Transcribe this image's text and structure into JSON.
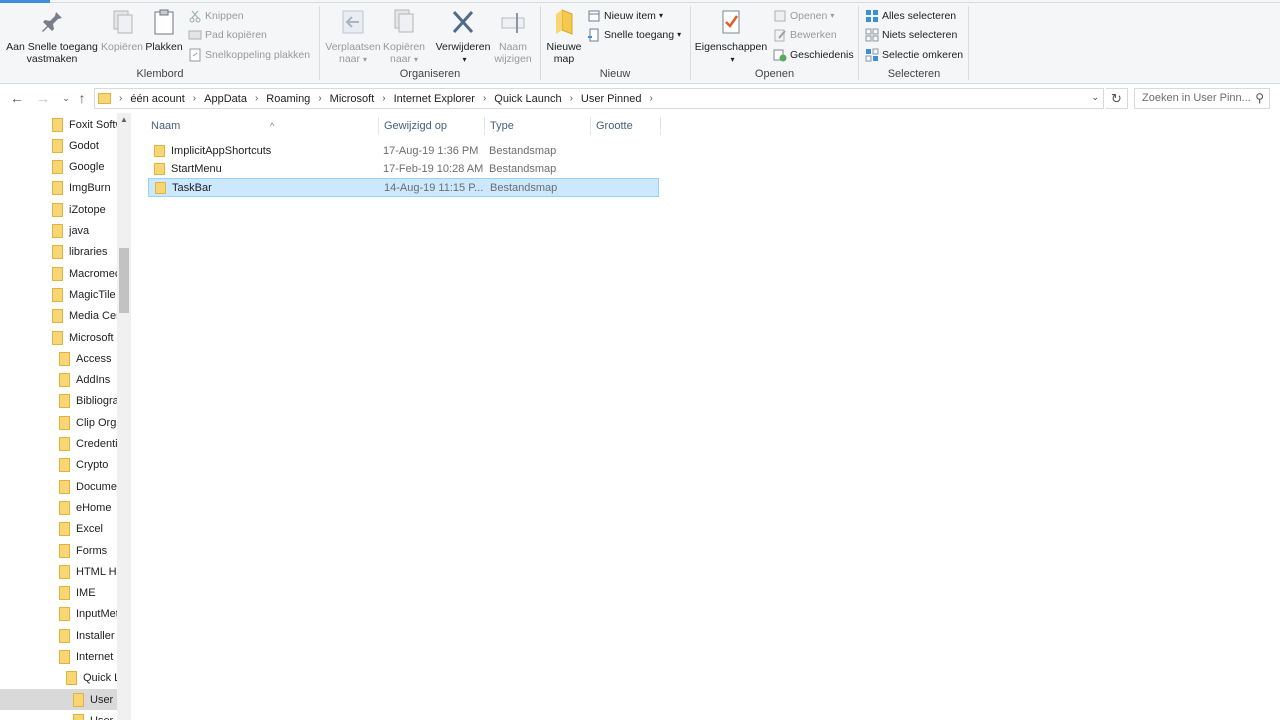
{
  "ribbon": {
    "klembord": {
      "label": "Klembord",
      "pin": "Aan Snelle toegang vastmaken",
      "copy": "Kopiëren",
      "paste": "Plakken",
      "cut": "Knippen",
      "copy_path": "Pad kopiëren",
      "paste_shortcut": "Snelkoppeling plakken"
    },
    "organiseren": {
      "label": "Organiseren",
      "move_to": "Verplaatsen naar",
      "copy_to": "Kopiëren naar",
      "delete": "Verwijderen",
      "rename": "Naam wijzigen"
    },
    "nieuw": {
      "label": "Nieuw",
      "new_folder": "Nieuwe map",
      "new_item": "Nieuw item",
      "easy_access": "Snelle toegang"
    },
    "openen": {
      "label": "Openen",
      "properties": "Eigenschappen",
      "open": "Openen",
      "edit": "Bewerken",
      "history": "Geschiedenis"
    },
    "selecteren": {
      "label": "Selecteren",
      "select_all": "Alles selecteren",
      "select_none": "Niets selecteren",
      "invert": "Selectie omkeren"
    }
  },
  "address": {
    "crumbs": [
      "één acount",
      "AppData",
      "Roaming",
      "Microsoft",
      "Internet Explorer",
      "Quick Launch",
      "User Pinned"
    ],
    "search_placeholder": "Zoeken in User Pinn..."
  },
  "nav": {
    "items": [
      {
        "label": "Foxit Softw",
        "level": 0
      },
      {
        "label": "Godot",
        "level": 0
      },
      {
        "label": "Google",
        "level": 0
      },
      {
        "label": "ImgBurn",
        "level": 0
      },
      {
        "label": "iZotope",
        "level": 0
      },
      {
        "label": "java",
        "level": 0
      },
      {
        "label": "libraries",
        "level": 0
      },
      {
        "label": "Macromec",
        "level": 0
      },
      {
        "label": "MagicTile",
        "level": 0
      },
      {
        "label": "Media Cer",
        "level": 0
      },
      {
        "label": "Microsoft",
        "level": 0
      },
      {
        "label": "Access",
        "level": 1
      },
      {
        "label": "AddIns",
        "level": 1
      },
      {
        "label": "Bibliogra",
        "level": 1
      },
      {
        "label": "Clip Orga",
        "level": 1
      },
      {
        "label": "Credentia",
        "level": 1
      },
      {
        "label": "Crypto",
        "level": 1
      },
      {
        "label": "Documer",
        "level": 1
      },
      {
        "label": "eHome",
        "level": 1
      },
      {
        "label": "Excel",
        "level": 1
      },
      {
        "label": "Forms",
        "level": 1
      },
      {
        "label": "HTML He",
        "level": 1
      },
      {
        "label": "IME",
        "level": 1
      },
      {
        "label": "InputMet",
        "level": 1
      },
      {
        "label": "Installer",
        "level": 1
      },
      {
        "label": "Internet E",
        "level": 1
      },
      {
        "label": "Quick L",
        "level": 2
      },
      {
        "label": "User P",
        "level": 3,
        "selected": true
      },
      {
        "label": "User Pi",
        "level": 3
      }
    ]
  },
  "columns": {
    "name": "Naam",
    "modified": "Gewijzigd op",
    "type": "Type",
    "size": "Grootte"
  },
  "files": [
    {
      "name": "ImplicitAppShortcuts",
      "modified": "17-Aug-19 1:36 PM",
      "type": "Bestandsmap",
      "selected": false
    },
    {
      "name": "StartMenu",
      "modified": "17-Feb-19 10:28 AM",
      "type": "Bestandsmap",
      "selected": false
    },
    {
      "name": "TaskBar",
      "modified": "14-Aug-19 11:15 P...",
      "type": "Bestandsmap",
      "selected": true
    }
  ]
}
